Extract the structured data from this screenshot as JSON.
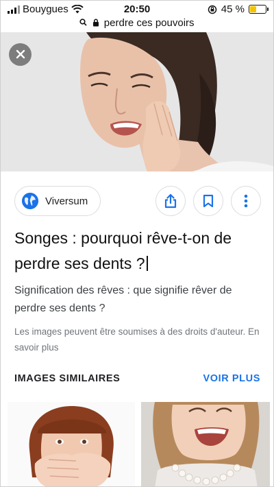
{
  "status_bar": {
    "carrier": "Bouygues",
    "time": "20:50",
    "battery": "45 %",
    "battery_level": 0.45
  },
  "url_bar": {
    "query": "perdre ces pouvoirs"
  },
  "source": {
    "name": "Viversum"
  },
  "article": {
    "title": "Songes : pourquoi rêve-t-on de perdre ses dents ?",
    "description": "Signification des rêves : que signifie rêver de perdre ses dents ?",
    "copyright": "Les images peuvent être soumises à des droits d'auteur. En savoir plus"
  },
  "similar": {
    "heading": "IMAGES SIMILAIRES",
    "more_label": "VOIR PLUS"
  },
  "colors": {
    "accent": "#1a73e8",
    "battery": "#f5c400"
  },
  "icons": [
    "wifi-icon",
    "lock-icon",
    "search-icon",
    "close-icon",
    "globe-icon",
    "share-icon",
    "bookmark-icon",
    "more-vert-icon"
  ]
}
